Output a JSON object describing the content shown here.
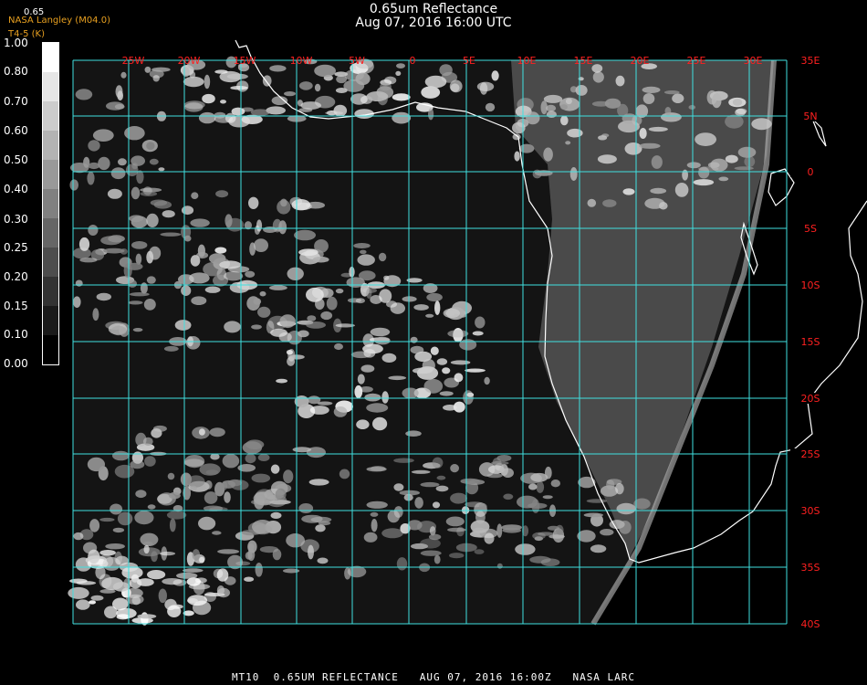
{
  "title": "0.65um Reflectance",
  "datetime": "Aug 07, 2016 16:00 UTC",
  "credit_top": "0.65",
  "credit": "NASA Langley (M04.0)",
  "credit_sub": "T4-5 (K)",
  "footer": "MT10  0.65UM REFLECTANCE   AUG 07, 2016 16:00Z   NASA LARC",
  "colorbar": {
    "labels": [
      "1.00",
      "0.80",
      "0.70",
      "0.60",
      "0.50",
      "0.40",
      "0.30",
      "0.25",
      "0.20",
      "0.15",
      "0.10",
      "0.00"
    ]
  },
  "map": {
    "grid_color": "#40e0e0",
    "label_color": "#ff2020",
    "coast_color": "#ffffff",
    "lon_labels": [
      "25W",
      "20W",
      "15W",
      "10W",
      "5W",
      "0",
      "5E",
      "10E",
      "15E",
      "20E",
      "25E",
      "30E"
    ],
    "lat_labels": [
      "35E",
      "5N",
      "0",
      "5S",
      "10S",
      "15S",
      "20S",
      "25S",
      "30S",
      "35S",
      "40S"
    ]
  }
}
